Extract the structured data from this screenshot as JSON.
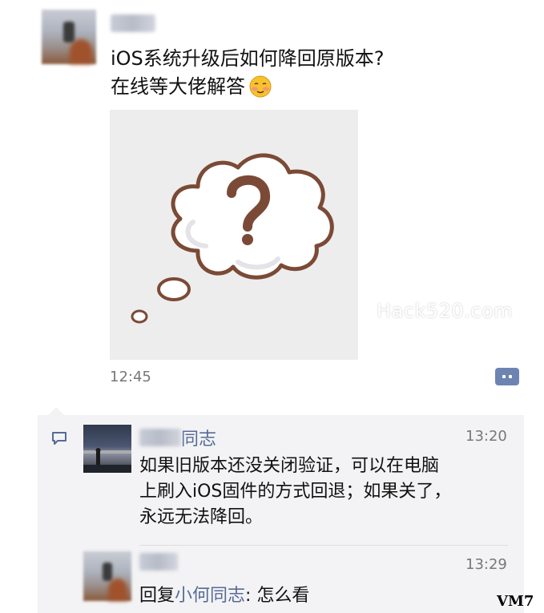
{
  "post": {
    "text_line1": "iOS系统升级后如何降回原版本?",
    "text_line2": "在线等大佬解答",
    "emoji": "shy-face-emoji",
    "image_watermark": "Hack520.com",
    "time": "12:45"
  },
  "comments": [
    {
      "name_suffix": "同志",
      "time": "13:20",
      "lines": [
        "如果旧版本还没关闭验证，可以在电脑",
        "上刷入iOS固件的方式回退；如果关了，",
        "永远无法降回。"
      ]
    },
    {
      "time": "13:29",
      "reply_prefix": "回复",
      "reply_target": "小何同志",
      "reply_text": ": 怎么看"
    }
  ],
  "corner_watermark": "VM7",
  "colors": {
    "link_blue": "#576b95",
    "icon_blue": "#6d84b2",
    "cloud_outline": "#7b4a36"
  },
  "icons": [
    "comment-menu-icon",
    "comment-bubble-icon",
    "question-cloud-icon"
  ]
}
